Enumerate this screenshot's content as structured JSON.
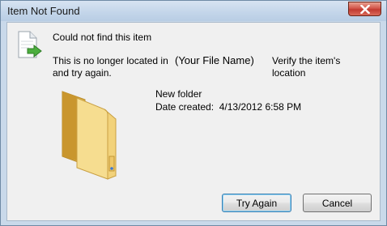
{
  "window": {
    "title": "Item Not Found"
  },
  "dialog": {
    "heading": "Could not find this item",
    "message_part1": "This is no longer located in",
    "file_name": "(Your File Name)",
    "message_part2": "Verify the item's location",
    "message_line2": "and try again."
  },
  "item": {
    "name": "New folder",
    "date_label": "Date created:",
    "date_value": "4/13/2012 6:58 PM"
  },
  "buttons": {
    "try_again": "Try Again",
    "cancel": "Cancel"
  },
  "icons": {
    "close": "close-icon",
    "document": "document-arrow-icon",
    "folder": "folder-icon"
  }
}
